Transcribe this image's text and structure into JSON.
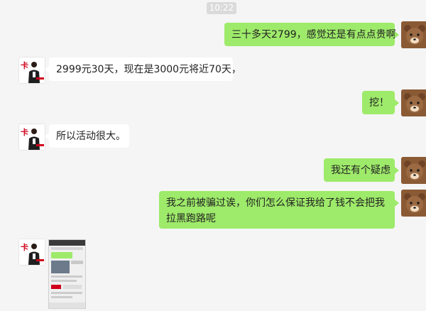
{
  "timestamp": "10:22",
  "colors": {
    "background": "#f5f5f5",
    "my_bubble": "#9eea6a",
    "their_bubble": "#ffffff",
    "timestamp_badge": "#dadada"
  },
  "icons": {
    "my_avatar": "brown-bear-avatar-icon",
    "their_avatar": "business-person-logo-avatar-icon"
  },
  "messages": [
    {
      "from": "me",
      "text": "三十多天2799，感觉还是有点点贵啊"
    },
    {
      "from": "them",
      "text": "2999元30天，现在是3000元将近70天，"
    },
    {
      "from": "me",
      "text": "挖！"
    },
    {
      "from": "them",
      "text": "所以活动很大。"
    },
    {
      "from": "me",
      "text": "我还有个疑虑"
    },
    {
      "from": "me",
      "text": "我之前被骗过诶，你们怎么保证我给了钱不会把我拉黑跑路呢"
    },
    {
      "from": "them",
      "type": "image",
      "text": ""
    }
  ]
}
